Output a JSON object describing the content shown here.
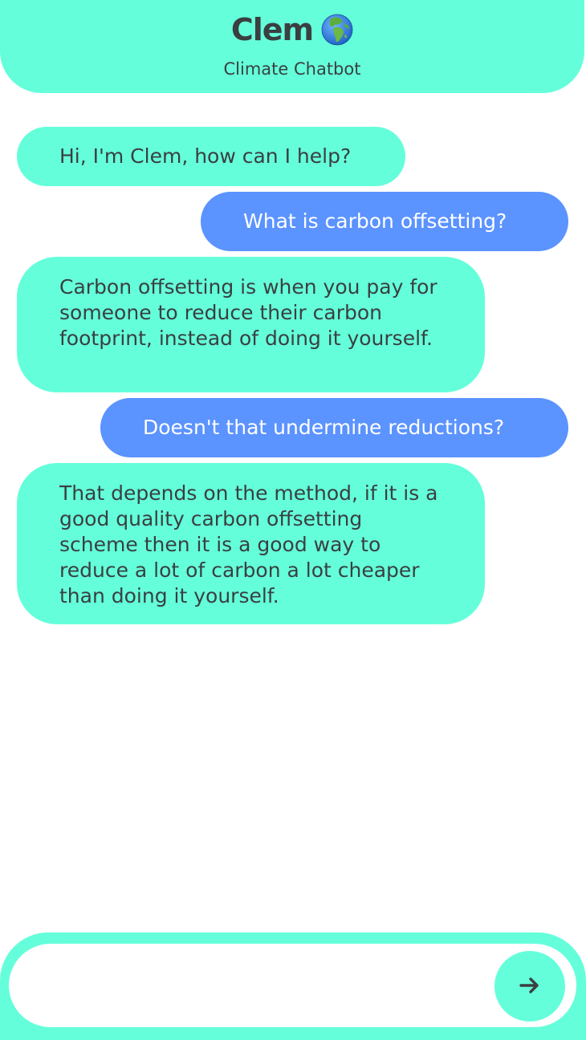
{
  "header": {
    "title": "Clem",
    "title_icon": "globe-europe-africa-icon",
    "subtitle": "Climate Chatbot"
  },
  "messages": [
    {
      "sender": "bot",
      "text": "Hi, I'm Clem, how can I help?"
    },
    {
      "sender": "user",
      "text": "What is carbon offsetting?"
    },
    {
      "sender": "bot",
      "text": "Carbon offsetting is when you pay for someone to reduce their carbon footprint, instead of doing it yourself."
    },
    {
      "sender": "user",
      "text": "Doesn't that undermine reductions?"
    },
    {
      "sender": "bot",
      "text": "That depends on the method, if it is a good quality carbon offsetting scheme then it is a good way to reduce a lot of carbon a lot cheaper than doing it yourself."
    }
  ],
  "composer": {
    "input_value": "",
    "input_placeholder": "",
    "send_icon": "arrow-right-icon"
  },
  "colors": {
    "accent": "#64ffda",
    "user_bubble": "#5b93ff",
    "text_dark": "#3a3f41",
    "background": "#ffffff"
  }
}
